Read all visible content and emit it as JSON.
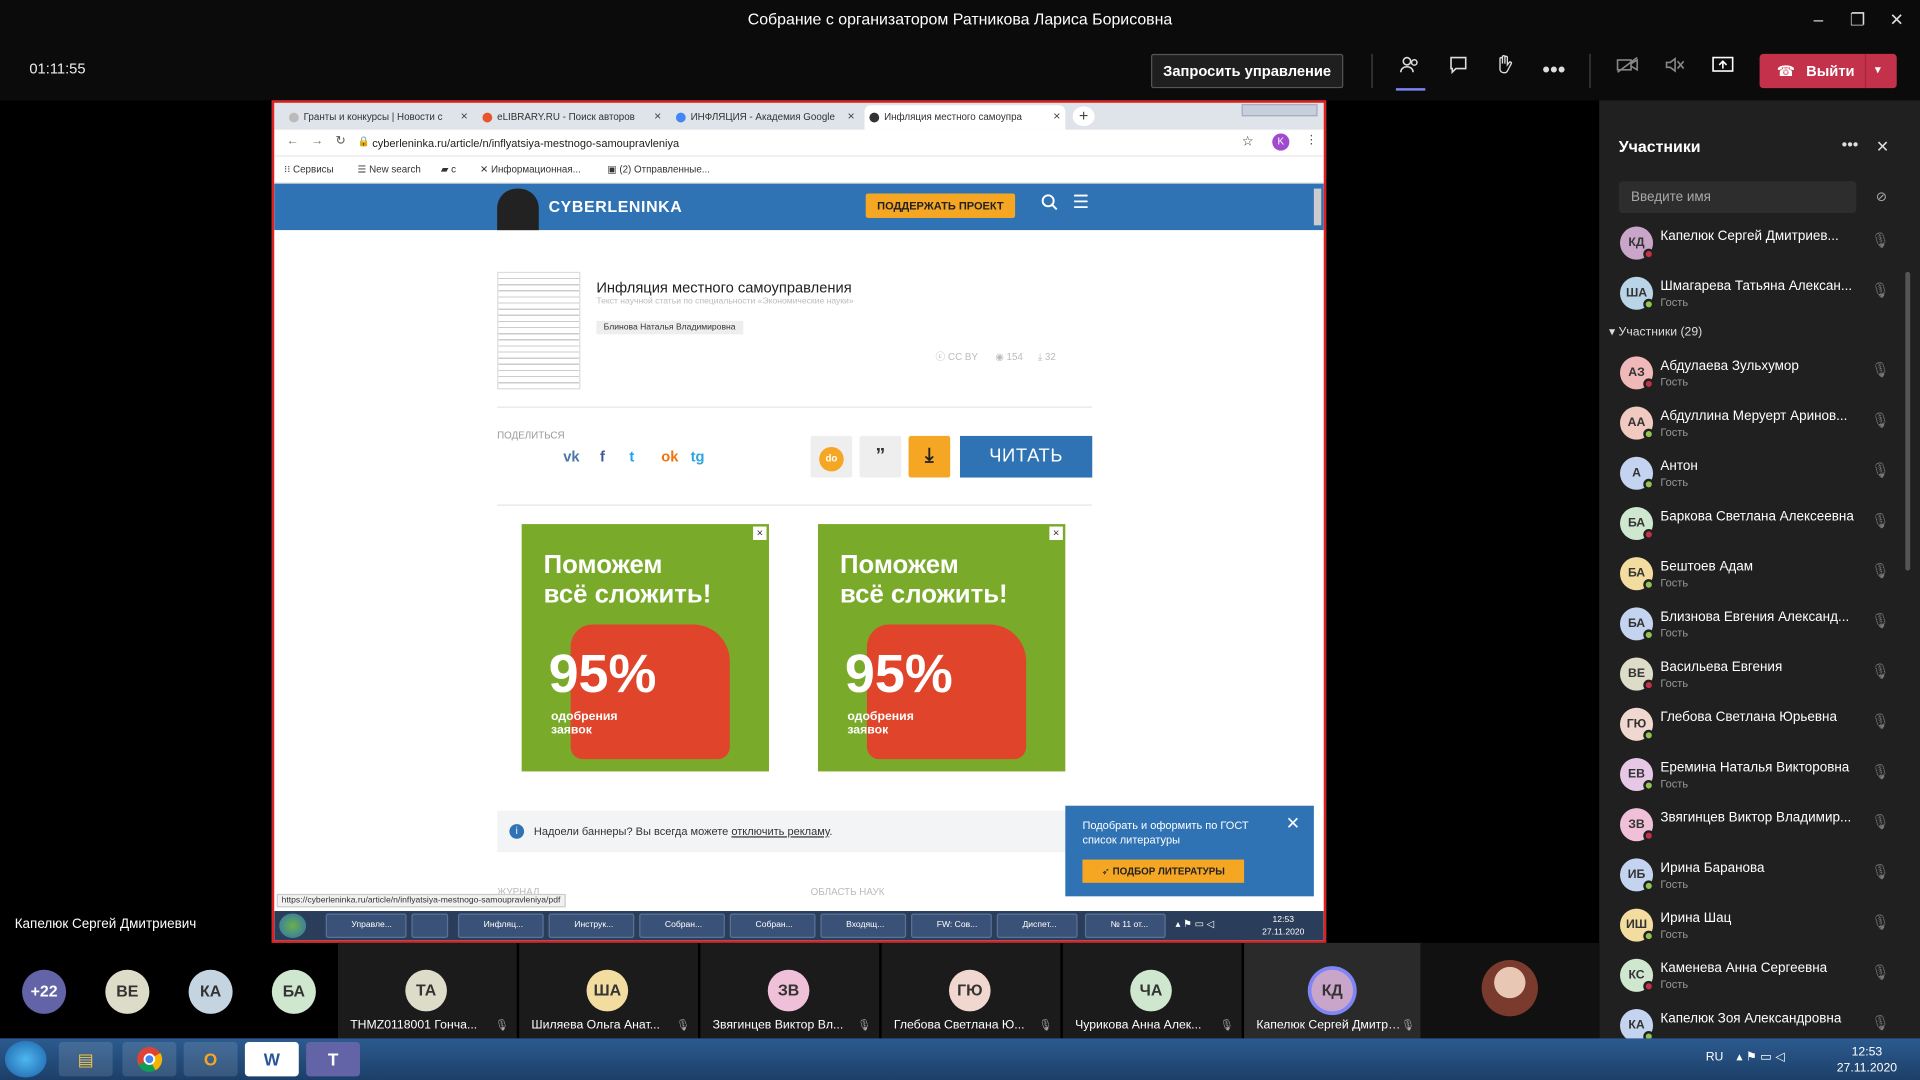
{
  "window": {
    "title": "Собрание с организатором Ратникова Лариса Борисовна",
    "minimize": "–",
    "maximize": "❐",
    "close": "✕"
  },
  "toolbar": {
    "timer": "01:11:55",
    "request_control": "Запросить управление",
    "leave": "Выйти",
    "icons": [
      "people-icon",
      "chat-icon",
      "raise-hand-icon",
      "more-icon",
      "camera-off-icon",
      "mic-off-icon",
      "share-icon"
    ]
  },
  "browser": {
    "tabs": [
      {
        "label": "Гранты и конкурсы | Новости с",
        "close": "×"
      },
      {
        "label": "eLIBRARY.RU - Поиск авторов",
        "close": "×"
      },
      {
        "label": "ИНФЛЯЦИЯ - Академия Google",
        "close": "×"
      },
      {
        "label": "Инфляция местного самоупра",
        "close": "×"
      }
    ],
    "new_tab": "+",
    "url": "cyberleninka.ru/article/n/inflyatsiya-mestnogo-samoupravleniya",
    "profile": "K",
    "bookmarks": [
      "Сервисы",
      "New search",
      "с",
      "Информационная...",
      "(2) Отправленные..."
    ],
    "status_url": "https://cyberleninka.ru/article/n/inflyatsiya-mestnogo-samoupravleniya/pdf"
  },
  "site": {
    "logo": "CYBERLENINKA",
    "support_button": "ПОДДЕРЖАТЬ ПРОЕКТ",
    "article_title": "Инфляция местного самоуправления",
    "article_sub": "Текст научной статьи по специальности «Экономические науки»",
    "author": "Блинова Наталья Владимировна",
    "license": "CC BY",
    "views": "154",
    "downloads": "32",
    "share_label": "ПОДЕЛИТЬСЯ",
    "social": [
      "vk",
      "f",
      "t",
      "ok",
      "tg"
    ],
    "quote_symbol": "”",
    "download_symbol": "⤓",
    "read_button": "ЧИТАТЬ",
    "ad": {
      "headline_1": "Поможем",
      "headline_2": "всё сложить!",
      "percent": "95%",
      "note_1": "одобрения",
      "note_2": "заявок",
      "close": "×"
    },
    "banner_note_prefix": "Надоели баннеры? Вы всегда можете ",
    "banner_note_link": "отключить рекламу",
    "banner_note_suffix": ".",
    "gost_text": "Подобрать и оформить по ГОСТ список литературы",
    "gost_button": "ПОДБОР ЛИТЕРАТУРЫ",
    "journal_label": "ЖУРНАЛ",
    "science_label": "ОБЛАСТЬ НАУК"
  },
  "inner_taskbar": {
    "items": [
      "Управле...",
      "",
      "Инфляц...",
      "Инструк...",
      "Собран...",
      "Собран...",
      "Входящ...",
      "FW: Сов...",
      "Диспет...",
      "№ 11 от..."
    ],
    "time": "12:53",
    "date": "27.11.2020"
  },
  "presenter": {
    "name": "Капелюк Сергей Дмитриевич"
  },
  "panel": {
    "title": "Участники",
    "search_placeholder": "Введите имя",
    "group_label": "Участники (29)",
    "guest": "Гость",
    "presenters": [
      {
        "initials": "КД",
        "name": "Капелюк Сергей Дмитриев...",
        "role": "",
        "color": "#c9a6c9"
      },
      {
        "initials": "ША",
        "name": "Шмагарева Татьяна Алексан...",
        "role": "Гость",
        "color": "#b9d4e6"
      }
    ],
    "attendees": [
      {
        "initials": "АЗ",
        "name": "Абдулаева Зульхумор",
        "role": "Гость",
        "color": "#f0b8b8"
      },
      {
        "initials": "АА",
        "name": "Абдуллина Меруерт Аринов...",
        "role": "Гость",
        "color": "#f0c9c0"
      },
      {
        "initials": "А",
        "name": "Антон",
        "role": "Гость",
        "color": "#c4d4f0"
      },
      {
        "initials": "БА",
        "name": "Баркова Светлана Алексеевна",
        "role": "",
        "color": "#cfe6cf"
      },
      {
        "initials": "БА",
        "name": "Бештоев Адам",
        "role": "Гость",
        "color": "#f3dca0"
      },
      {
        "initials": "БА",
        "name": "Близнова Евгения Александ...",
        "role": "Гость",
        "color": "#c4d4f0"
      },
      {
        "initials": "ВЕ",
        "name": "Васильева Евгения",
        "role": "Гость",
        "color": "#dcdcc8"
      },
      {
        "initials": "ГЮ",
        "name": "Глебова Светлана Юрьевна",
        "role": "",
        "color": "#f0d8d0"
      },
      {
        "initials": "ЕВ",
        "name": "Еремина Наталья Викторовна",
        "role": "Гость",
        "color": "#e6c8e6"
      },
      {
        "initials": "ЗВ",
        "name": "Звягинцев Виктор Владимир...",
        "role": "",
        "color": "#f0c0d8"
      },
      {
        "initials": "ИБ",
        "name": "Ирина Баранова",
        "role": "Гость",
        "color": "#c4d4f0"
      },
      {
        "initials": "ИШ",
        "name": "Ирина Шац",
        "role": "Гость",
        "color": "#f3dca0"
      },
      {
        "initials": "КС",
        "name": "Каменева Анна Сергеевна",
        "role": "Гость",
        "color": "#cfe6cf"
      },
      {
        "initials": "КА",
        "name": "Капелюк Зоя Александровна",
        "role": "",
        "color": "#c4d4f0"
      }
    ]
  },
  "gallery": {
    "small": [
      {
        "initials": "+22",
        "color": "#6264a7"
      },
      {
        "initials": "ВЕ",
        "color": "#dcdcc8"
      },
      {
        "initials": "КА",
        "color": "#c4d4e0"
      },
      {
        "initials": "БА",
        "color": "#cfe6cf"
      }
    ],
    "tiles": [
      {
        "initials": "ТА",
        "name": "THMZ0118001 Гонча...",
        "color": "#dcdcc8"
      },
      {
        "initials": "ША",
        "name": "Шиляева Ольга Анат...",
        "color": "#f3dca0"
      },
      {
        "initials": "ЗВ",
        "name": "Звягинцев Виктор Вл...",
        "color": "#f0c0d8"
      },
      {
        "initials": "ГЮ",
        "name": "Глебова Светлана Ю...",
        "color": "#f0d8d0"
      },
      {
        "initials": "ЧА",
        "name": "Чурикова Анна Алек...",
        "color": "#cfe6cf"
      },
      {
        "initials": "КД",
        "name": "Капелюк Сергей Дмитри...",
        "color": "#c9a6c9"
      }
    ]
  },
  "win_taskbar": {
    "lang": "RU",
    "time": "12:53",
    "date": "27.11.2020"
  }
}
